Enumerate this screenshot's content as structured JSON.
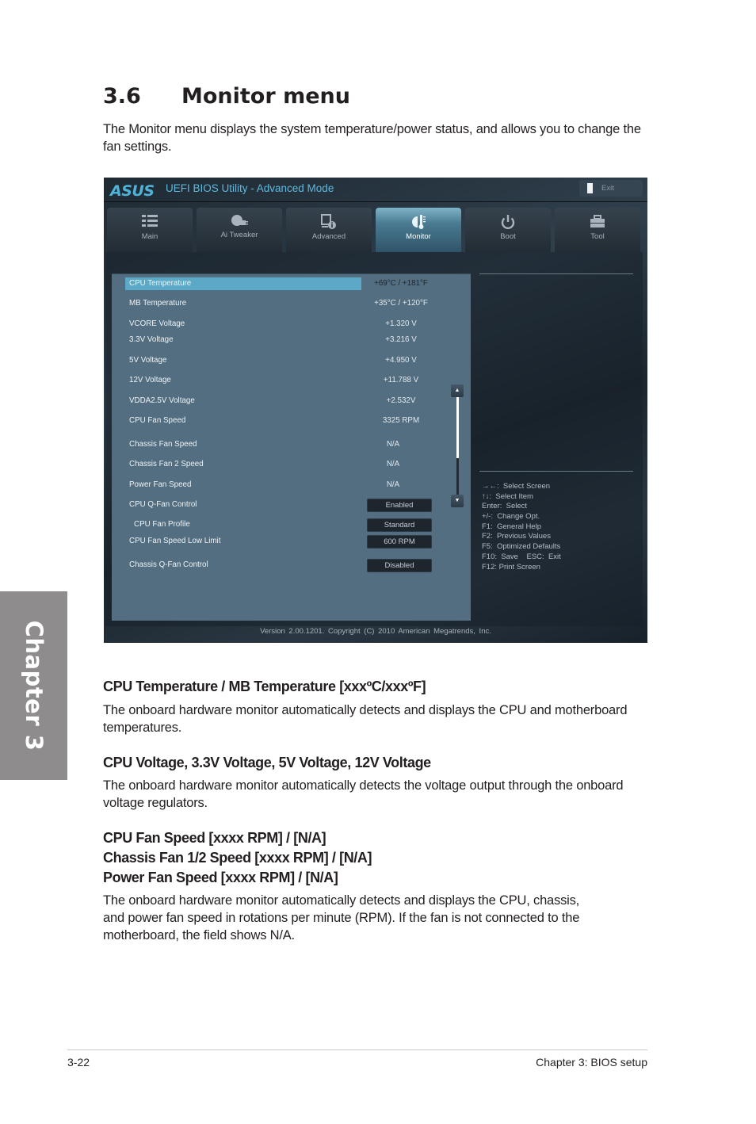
{
  "chapter_tab": "Chapter 3",
  "section": {
    "number": "3.6",
    "title": "Monitor menu",
    "intro": "The Monitor menu displays the system temperature/power status, and allows you to change the fan settings."
  },
  "bios": {
    "logo": "ASUS",
    "title": "UEFI BIOS Utility - Advanced Mode",
    "exit_label": "Exit",
    "tabs": [
      {
        "label": "Main",
        "icon": "list-icon",
        "active": false
      },
      {
        "label": "Ai  Tweaker",
        "icon": "tweaker-icon",
        "active": false
      },
      {
        "label": "Advanced",
        "icon": "advanced-info-icon",
        "active": false
      },
      {
        "label": "Monitor",
        "icon": "thermometer-icon",
        "active": true
      },
      {
        "label": "Boot",
        "icon": "power-icon",
        "active": false
      },
      {
        "label": "Tool",
        "icon": "toolbox-icon",
        "active": false
      }
    ],
    "rows": [
      {
        "label": "CPU Temperature",
        "value": "+69°C / +181°F"
      },
      {
        "label": "MB Temperature",
        "value": "+35°C / +120°F"
      },
      {
        "label": "VCORE Voltage",
        "value": "+1.320 V"
      },
      {
        "label": "3.3V Voltage",
        "value": "+3.216 V"
      },
      {
        "label": "5V Voltage",
        "value": "+4.950 V"
      },
      {
        "label": "12V Voltage",
        "value": "+11.788 V"
      },
      {
        "label": "VDDA2.5V Voltage",
        "value": "+2.532V"
      },
      {
        "label": "CPU Fan Speed",
        "value": "3325 RPM"
      },
      {
        "label": "Chassis Fan Speed",
        "value": "N/A"
      },
      {
        "label": "Chassis Fan 2 Speed",
        "value": "N/A"
      },
      {
        "label": "Power Fan Speed",
        "value": "N/A"
      },
      {
        "label": "CPU Q-Fan Control",
        "option": "Enabled"
      },
      {
        "label": "CPU Fan Profile",
        "option": "Standard"
      },
      {
        "label": "CPU Fan Speed Low Limit",
        "option": "600 RPM"
      },
      {
        "label": "Chassis Q-Fan Control",
        "option": "Disabled"
      }
    ],
    "selected_row": "CPU Temperature",
    "scroll_position_fraction": 0.0,
    "help": [
      "→←:  Select Screen",
      "↑↓:  Select Item",
      "Enter:  Select",
      "+/-:  Change Opt.",
      "F1:  General Help",
      "F2:  Previous Values",
      "F5:  Optimized Defaults",
      "F10:  Save    ESC:  Exit",
      "F12: Print Screen"
    ],
    "version": "Version  2.00.1201.  Copyright  (C)  2010  American  Megatrends,  Inc.",
    "colors": {
      "accent": "#5ba9c6",
      "panel": "#536e80",
      "title": "#5fb9dd"
    }
  },
  "items": [
    {
      "heading": "CPU Temperature / MB Temperature [xxxºC/xxxºF]",
      "body": "The onboard hardware monitor automatically detects and displays the CPU and motherboard temperatures."
    },
    {
      "heading": "CPU Voltage, 3.3V Voltage, 5V Voltage, 12V Voltage",
      "body": "The onboard hardware monitor automatically detects the voltage output through the onboard voltage regulators."
    },
    {
      "heading_lines": [
        "CPU Fan Speed [xxxx RPM] / [N/A]",
        "Chassis Fan 1/2 Speed [xxxx RPM] / [N/A]",
        "Power Fan Speed [xxxx RPM] / [N/A]"
      ],
      "body_lines": [
        "The onboard hardware monitor automatically detects and displays the CPU, chassis,",
        "and power fan speed in rotations per minute (RPM). If the fan is not connected to the",
        "motherboard, the field shows N/A."
      ]
    }
  ],
  "footer": {
    "page": "3-22",
    "chapter": "Chapter 3: BIOS setup"
  }
}
